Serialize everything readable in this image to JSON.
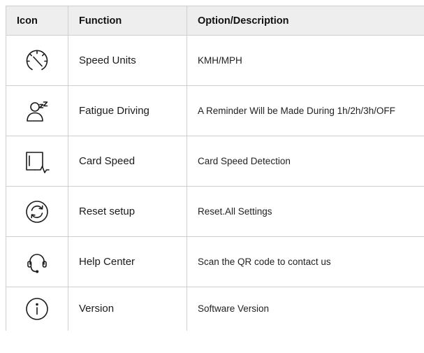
{
  "table": {
    "headers": {
      "icon": "Icon",
      "function": "Function",
      "description": "Option/Description"
    },
    "rows": [
      {
        "icon": "speedometer-icon",
        "function": "Speed Units",
        "description": "KMH/MPH"
      },
      {
        "icon": "fatigue-sleep-icon",
        "function": "Fatigue Driving",
        "description": "A Reminder Will be Made During 1h/2h/3h/OFF"
      },
      {
        "icon": "card-speed-icon",
        "function": "Card Speed",
        "description": "Card Speed Detection"
      },
      {
        "icon": "reset-icon",
        "function": "Reset setup",
        "description": "Reset.All Settings"
      },
      {
        "icon": "headset-icon",
        "function": "Help Center",
        "description": "Scan the QR code to contact us"
      },
      {
        "icon": "info-icon",
        "function": "Version",
        "description": "Software Version"
      }
    ]
  }
}
